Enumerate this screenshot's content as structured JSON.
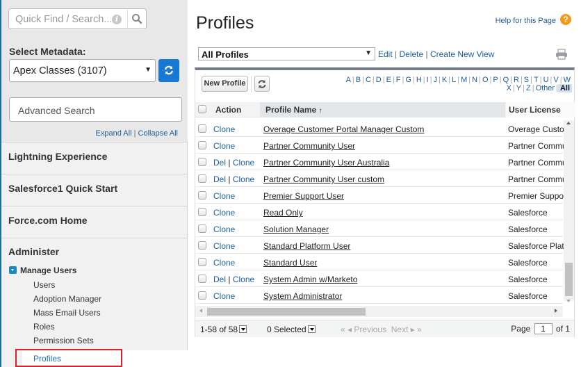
{
  "sidebar": {
    "quick_find_placeholder": "Quick Find / Search...",
    "select_metadata_label": "Select Metadata:",
    "select_metadata_value": "Apex Classes (3107)",
    "advanced_search_label": "Advanced Search",
    "expand_all": "Expand All",
    "collapse_all": "Collapse All",
    "link_separator": "|",
    "sections": [
      "Lightning Experience",
      "Salesforce1 Quick Start",
      "Force.com Home",
      "Administer"
    ],
    "tree": {
      "group": "Manage Users",
      "items": [
        "Users",
        "Adoption Manager",
        "Mass Email Users",
        "Roles",
        "Permission Sets",
        "Profiles"
      ],
      "active": "Profiles"
    },
    "colors": {
      "accent": "#1779d3",
      "highlight_box": "#e01e2b"
    }
  },
  "header": {
    "title": "Profiles",
    "help_link": "Help for this Page",
    "help_icon": "?"
  },
  "view": {
    "selected": "All Profiles",
    "links": [
      "Edit",
      "Delete",
      "Create New View"
    ]
  },
  "toolbar": {
    "new_profile": "New Profile",
    "alphabet": [
      "A",
      "B",
      "C",
      "D",
      "E",
      "F",
      "G",
      "H",
      "I",
      "J",
      "K",
      "L",
      "M",
      "N",
      "O",
      "P",
      "Q",
      "R",
      "S",
      "T",
      "U",
      "V",
      "W",
      "X",
      "Y",
      "Z",
      "Other",
      "All"
    ],
    "alphabet_active": "All"
  },
  "table": {
    "columns": {
      "action": "Action",
      "profile_name": "Profile Name",
      "sort_indicator": "↑",
      "user_license": "User License"
    },
    "rows": [
      {
        "actions": [
          "Clone"
        ],
        "name": "Overage Customer Portal Manager Custom",
        "license": "Overage Customer Portal Manager"
      },
      {
        "actions": [
          "Clone"
        ],
        "name": "Partner Community User",
        "license": "Partner Community"
      },
      {
        "actions": [
          "Del",
          "Clone"
        ],
        "name": "Partner Community User Australia",
        "license": "Partner Community"
      },
      {
        "actions": [
          "Del",
          "Clone"
        ],
        "name": "Partner Community User custom",
        "license": "Partner Community"
      },
      {
        "actions": [
          "Clone"
        ],
        "name": "Premier Support User",
        "license": "Premier Support"
      },
      {
        "actions": [
          "Clone"
        ],
        "name": "Read Only",
        "license": "Salesforce"
      },
      {
        "actions": [
          "Clone"
        ],
        "name": "Solution Manager",
        "license": "Salesforce"
      },
      {
        "actions": [
          "Clone"
        ],
        "name": "Standard Platform User",
        "license": "Salesforce Platform"
      },
      {
        "actions": [
          "Clone"
        ],
        "name": "Standard User",
        "license": "Salesforce"
      },
      {
        "actions": [
          "Del",
          "Clone"
        ],
        "name": "System Admin w/Marketo",
        "license": "Salesforce"
      },
      {
        "actions": [
          "Clone"
        ],
        "name": "System Administrator",
        "license": "Salesforce"
      }
    ]
  },
  "footer": {
    "record_count": "1-58 of 58",
    "selected": "0 Selected",
    "previous": "Previous",
    "next": "Next",
    "page_label": "Page",
    "page_value": "1",
    "page_of": "of 1"
  }
}
